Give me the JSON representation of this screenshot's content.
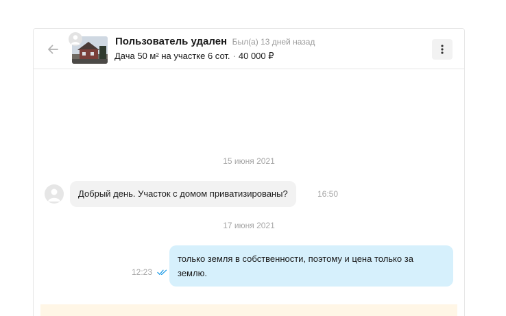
{
  "header": {
    "username": "Пользователь удален",
    "last_seen": "Был(а) 13 дней назад",
    "listing_title": "Дача 50 м² на участке 6 сот.",
    "separator": "·",
    "price": "40 000 ₽"
  },
  "icons": {
    "back": "arrow-left-icon",
    "menu": "kebab-menu-icon",
    "avatar": "user-avatar-icon",
    "read_status": "double-check-icon"
  },
  "colors": {
    "incoming_bubble": "#f2f2f2",
    "outgoing_bubble": "#d6f0fc",
    "read_check": "#1e9be6",
    "notice_banner": "#fff6e6"
  },
  "messages": [
    {
      "date": "15 июня 2021",
      "direction": "incoming",
      "text": "Добрый день. Участок с домом приватизированы?",
      "time": "16:50"
    },
    {
      "date": "17 июня 2021",
      "direction": "outgoing",
      "text": "только земля в собственности, поэтому и цена только за землю.",
      "time": "12:23",
      "read": true
    }
  ]
}
